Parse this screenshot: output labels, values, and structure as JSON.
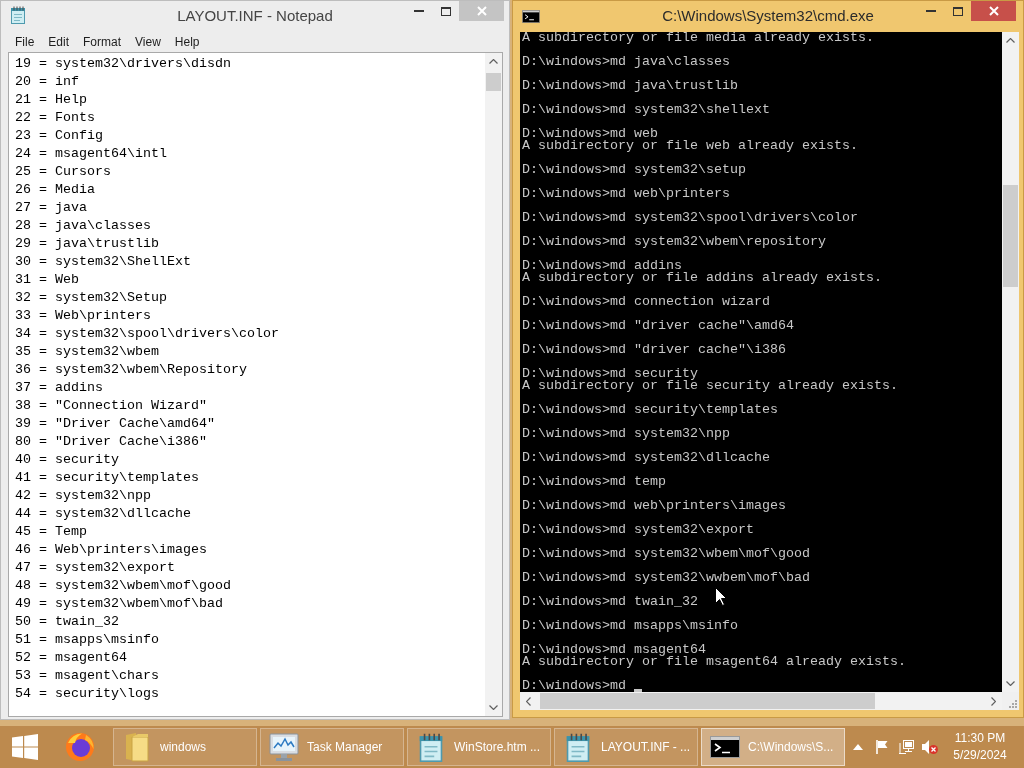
{
  "notepad": {
    "title": "LAYOUT.INF - Notepad",
    "active": false,
    "menu": [
      "File",
      "Edit",
      "Format",
      "View",
      "Help"
    ],
    "lines": [
      "19 = system32\\drivers\\disdn",
      "20 = inf",
      "21 = Help",
      "22 = Fonts",
      "23 = Config",
      "24 = msagent64\\intl",
      "25 = Cursors",
      "26 = Media",
      "27 = java",
      "28 = java\\classes",
      "29 = java\\trustlib",
      "30 = system32\\ShellExt",
      "31 = Web",
      "32 = system32\\Setup",
      "33 = Web\\printers",
      "34 = system32\\spool\\drivers\\color",
      "35 = system32\\wbem",
      "36 = system32\\wbem\\Repository",
      "37 = addins",
      "38 = \"Connection Wizard\"",
      "39 = \"Driver Cache\\amd64\"",
      "80 = \"Driver Cache\\i386\"",
      "40 = security",
      "41 = security\\templates",
      "42 = system32\\npp",
      "44 = system32\\dllcache",
      "45 = Temp",
      "46 = Web\\printers\\images",
      "47 = system32\\export",
      "48 = system32\\wbem\\mof\\good",
      "49 = system32\\wbem\\mof\\bad",
      "50 = twain_32",
      "51 = msapps\\msinfo",
      "52 = msagent64",
      "53 = msagent\\chars",
      "54 = security\\logs"
    ]
  },
  "console": {
    "title": "C:\\Windows\\System32\\cmd.exe",
    "active": true,
    "cursor": true,
    "lines": [
      {
        "kind": "output",
        "text": "A subdirectory or file media already exists."
      },
      {
        "kind": "command",
        "text": "D:\\windows>md java\\classes"
      },
      {
        "kind": "command",
        "text": "D:\\windows>md java\\trustlib"
      },
      {
        "kind": "command",
        "text": "D:\\windows>md system32\\shellext"
      },
      {
        "kind": "command",
        "text": "D:\\windows>md web"
      },
      {
        "kind": "output",
        "text": "A subdirectory or file web already exists."
      },
      {
        "kind": "command",
        "text": "D:\\windows>md system32\\setup"
      },
      {
        "kind": "command",
        "text": "D:\\windows>md web\\printers"
      },
      {
        "kind": "command",
        "text": "D:\\windows>md system32\\spool\\drivers\\color"
      },
      {
        "kind": "command",
        "text": "D:\\windows>md system32\\wbem\\repository"
      },
      {
        "kind": "command",
        "text": "D:\\windows>md addins"
      },
      {
        "kind": "output",
        "text": "A subdirectory or file addins already exists."
      },
      {
        "kind": "command",
        "text": "D:\\windows>md connection wizard"
      },
      {
        "kind": "command",
        "text": "D:\\windows>md \"driver cache\"\\amd64"
      },
      {
        "kind": "command",
        "text": "D:\\windows>md \"driver cache\"\\i386"
      },
      {
        "kind": "command",
        "text": "D:\\windows>md security"
      },
      {
        "kind": "output",
        "text": "A subdirectory or file security already exists."
      },
      {
        "kind": "command",
        "text": "D:\\windows>md security\\templates"
      },
      {
        "kind": "command",
        "text": "D:\\windows>md system32\\npp"
      },
      {
        "kind": "command",
        "text": "D:\\windows>md system32\\dllcache"
      },
      {
        "kind": "command",
        "text": "D:\\windows>md temp"
      },
      {
        "kind": "command",
        "text": "D:\\windows>md web\\printers\\images"
      },
      {
        "kind": "command",
        "text": "D:\\windows>md system32\\export"
      },
      {
        "kind": "command",
        "text": "D:\\windows>md system32\\wbem\\mof\\good"
      },
      {
        "kind": "command",
        "text": "D:\\windows>md system32\\wwbem\\mof\\bad"
      },
      {
        "kind": "command",
        "text": "D:\\windows>md twain_32"
      },
      {
        "kind": "command",
        "text": "D:\\windows>md msapps\\msinfo"
      },
      {
        "kind": "command",
        "text": "D:\\windows>md msagent64"
      },
      {
        "kind": "output",
        "text": "A subdirectory or file msagent64 already exists."
      },
      {
        "kind": "command",
        "text": "D:\\windows>md"
      }
    ]
  },
  "taskbar": {
    "buttons": [
      {
        "kind": "explorer",
        "label": "windows",
        "selected": false
      },
      {
        "kind": "taskmgr",
        "label": "Task Manager",
        "selected": false
      },
      {
        "kind": "notepad",
        "label": "WinStore.htm ...",
        "selected": false
      },
      {
        "kind": "notepad",
        "label": "LAYOUT.INF - ...",
        "selected": false
      },
      {
        "kind": "console",
        "label": "C:\\Windows\\S...",
        "selected": true
      }
    ],
    "tray": {
      "volume_muted": true,
      "time": "11:30 PM",
      "date": "5/29/2024"
    }
  }
}
